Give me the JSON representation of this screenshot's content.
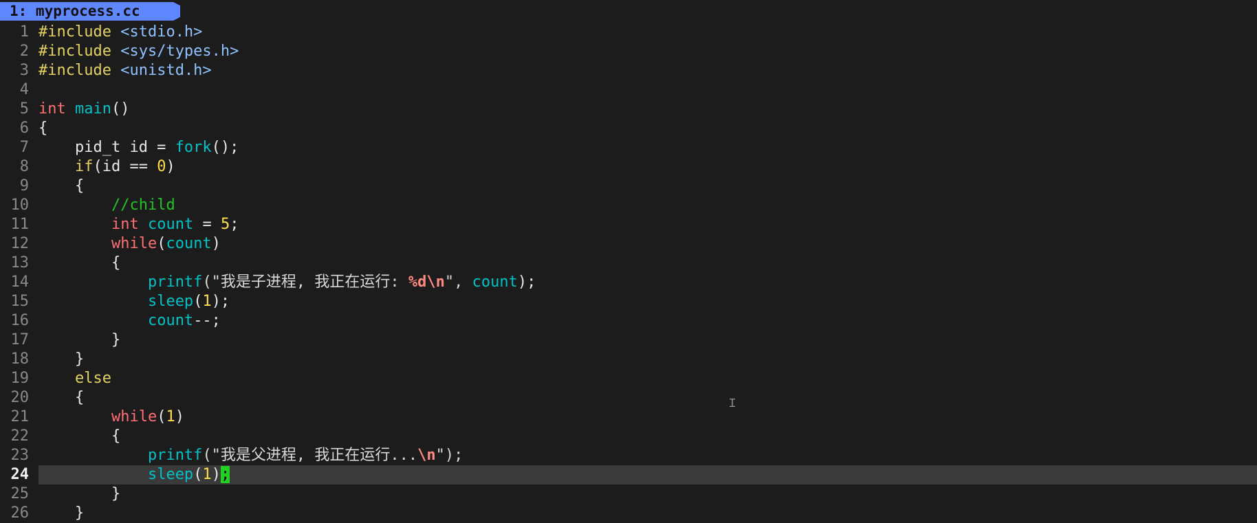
{
  "tabline": {
    "tab_label": "1: myprocess.cc"
  },
  "editor": {
    "current_line": 24,
    "lines": [
      {
        "n": "1",
        "current": false,
        "tokens": [
          {
            "t": "#include ",
            "c": "pre"
          },
          {
            "t": "<stdio.h>",
            "c": "inc"
          }
        ]
      },
      {
        "n": "2",
        "current": false,
        "tokens": [
          {
            "t": "#include ",
            "c": "pre"
          },
          {
            "t": "<sys/types.h>",
            "c": "inc"
          }
        ]
      },
      {
        "n": "3",
        "current": false,
        "tokens": [
          {
            "t": "#include ",
            "c": "pre"
          },
          {
            "t": "<unistd.h>",
            "c": "inc"
          }
        ]
      },
      {
        "n": "4",
        "current": false,
        "tokens": []
      },
      {
        "n": "5",
        "current": false,
        "tokens": [
          {
            "t": "int",
            "c": "kw"
          },
          {
            "t": " ",
            "c": "plain"
          },
          {
            "t": "main",
            "c": "fn"
          },
          {
            "t": "()",
            "c": "plain"
          }
        ]
      },
      {
        "n": "6",
        "current": false,
        "tokens": [
          {
            "t": "{",
            "c": "plain"
          }
        ]
      },
      {
        "n": "7",
        "current": false,
        "tokens": [
          {
            "t": "    pid_t id = ",
            "c": "plain"
          },
          {
            "t": "fork",
            "c": "fn"
          },
          {
            "t": "();",
            "c": "plain"
          }
        ]
      },
      {
        "n": "8",
        "current": false,
        "tokens": [
          {
            "t": "    ",
            "c": "plain"
          },
          {
            "t": "if",
            "c": "pre"
          },
          {
            "t": "(id == ",
            "c": "plain"
          },
          {
            "t": "0",
            "c": "num"
          },
          {
            "t": ")",
            "c": "plain"
          }
        ]
      },
      {
        "n": "9",
        "current": false,
        "tokens": [
          {
            "t": "    {",
            "c": "plain"
          }
        ]
      },
      {
        "n": "10",
        "current": false,
        "tokens": [
          {
            "t": "        ",
            "c": "plain"
          },
          {
            "t": "//child",
            "c": "cmt"
          }
        ]
      },
      {
        "n": "11",
        "current": false,
        "tokens": [
          {
            "t": "        ",
            "c": "plain"
          },
          {
            "t": "int",
            "c": "kw"
          },
          {
            "t": " ",
            "c": "plain"
          },
          {
            "t": "count",
            "c": "id"
          },
          {
            "t": " = ",
            "c": "plain"
          },
          {
            "t": "5",
            "c": "num"
          },
          {
            "t": ";",
            "c": "plain"
          }
        ]
      },
      {
        "n": "12",
        "current": false,
        "tokens": [
          {
            "t": "        ",
            "c": "plain"
          },
          {
            "t": "while",
            "c": "kw"
          },
          {
            "t": "(",
            "c": "plain"
          },
          {
            "t": "count",
            "c": "id"
          },
          {
            "t": ")",
            "c": "plain"
          }
        ]
      },
      {
        "n": "13",
        "current": false,
        "tokens": [
          {
            "t": "        {",
            "c": "plain"
          }
        ]
      },
      {
        "n": "14",
        "current": false,
        "tokens": [
          {
            "t": "            ",
            "c": "plain"
          },
          {
            "t": "printf",
            "c": "fn"
          },
          {
            "t": "(\"我是子进程, 我正在运行: ",
            "c": "str"
          },
          {
            "t": "%d\\n",
            "c": "esc"
          },
          {
            "t": "\", ",
            "c": "str"
          },
          {
            "t": "count",
            "c": "id"
          },
          {
            "t": ");",
            "c": "plain"
          }
        ]
      },
      {
        "n": "15",
        "current": false,
        "tokens": [
          {
            "t": "            ",
            "c": "plain"
          },
          {
            "t": "sleep",
            "c": "fn"
          },
          {
            "t": "(",
            "c": "plain"
          },
          {
            "t": "1",
            "c": "num"
          },
          {
            "t": ");",
            "c": "plain"
          }
        ]
      },
      {
        "n": "16",
        "current": false,
        "tokens": [
          {
            "t": "            ",
            "c": "plain"
          },
          {
            "t": "count",
            "c": "id"
          },
          {
            "t": "--;",
            "c": "plain"
          }
        ]
      },
      {
        "n": "17",
        "current": false,
        "tokens": [
          {
            "t": "        }",
            "c": "plain"
          }
        ]
      },
      {
        "n": "18",
        "current": false,
        "tokens": [
          {
            "t": "    }",
            "c": "plain"
          }
        ]
      },
      {
        "n": "19",
        "current": false,
        "tokens": [
          {
            "t": "    ",
            "c": "plain"
          },
          {
            "t": "else",
            "c": "pre"
          }
        ]
      },
      {
        "n": "20",
        "current": false,
        "tokens": [
          {
            "t": "    {",
            "c": "plain"
          }
        ]
      },
      {
        "n": "21",
        "current": false,
        "tokens": [
          {
            "t": "        ",
            "c": "plain"
          },
          {
            "t": "while",
            "c": "kw"
          },
          {
            "t": "(",
            "c": "plain"
          },
          {
            "t": "1",
            "c": "num"
          },
          {
            "t": ")",
            "c": "plain"
          }
        ]
      },
      {
        "n": "22",
        "current": false,
        "tokens": [
          {
            "t": "        {",
            "c": "plain"
          }
        ]
      },
      {
        "n": "23",
        "current": false,
        "tokens": [
          {
            "t": "            ",
            "c": "plain"
          },
          {
            "t": "printf",
            "c": "fn"
          },
          {
            "t": "(\"我是父进程, 我正在运行...",
            "c": "str"
          },
          {
            "t": "\\n",
            "c": "esc"
          },
          {
            "t": "\");",
            "c": "str"
          }
        ]
      },
      {
        "n": "24",
        "current": true,
        "tokens": [
          {
            "t": "            ",
            "c": "plain"
          },
          {
            "t": "sleep",
            "c": "fn"
          },
          {
            "t": "(",
            "c": "plain"
          },
          {
            "t": "1",
            "c": "num"
          },
          {
            "t": ")",
            "c": "plain"
          },
          {
            "t": ";",
            "c": "cursor"
          }
        ]
      },
      {
        "n": "25",
        "current": false,
        "tokens": [
          {
            "t": "        }",
            "c": "plain"
          }
        ]
      },
      {
        "n": "26",
        "current": false,
        "tokens": [
          {
            "t": "    }",
            "c": "plain"
          }
        ]
      }
    ]
  },
  "colors": {
    "background": "#1c1c1c",
    "tab_background": "#5f87ff",
    "current_line_highlight": "#3a3a3a",
    "cursor": "#22d022"
  },
  "icons": {
    "mouse_cursor": "ibeam-cursor-icon"
  }
}
